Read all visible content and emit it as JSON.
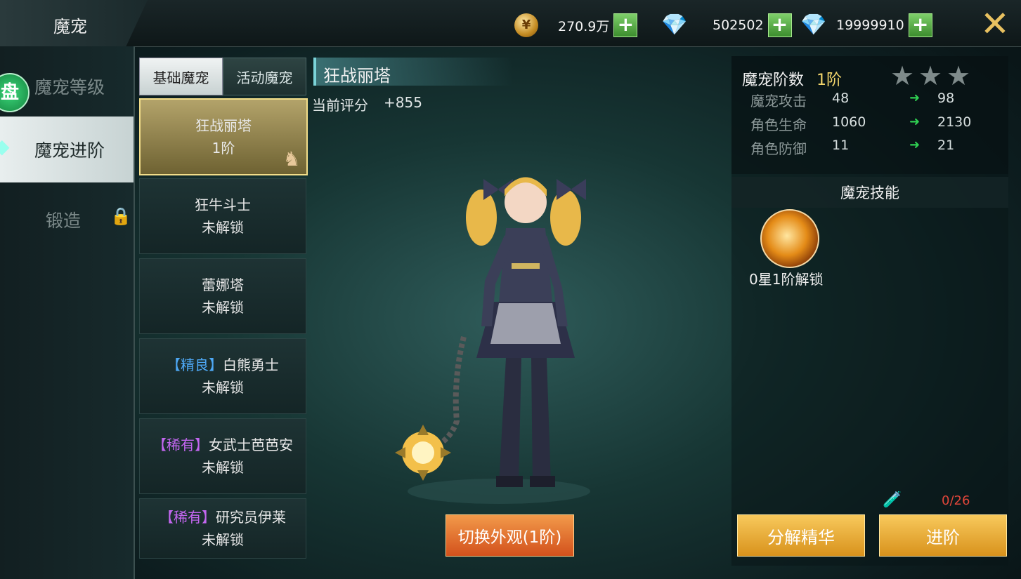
{
  "header": {
    "title": "魔宠",
    "gold": "270.9万",
    "diamond_blue": "502502",
    "diamond_bound": "19999910",
    "coin_glyph": "¥",
    "plus_label": "+",
    "close_label": "✕"
  },
  "sidebar": {
    "items": [
      {
        "label": "魔宠等级"
      },
      {
        "label": "魔宠进阶"
      },
      {
        "label": "锻造"
      }
    ],
    "badge": "盘"
  },
  "tabs": {
    "basic": "基础魔宠",
    "event": "活动魔宠"
  },
  "pets": [
    {
      "tag": "",
      "name": "狂战丽塔",
      "status": "1阶"
    },
    {
      "tag": "",
      "name": "狂牛斗士",
      "status": "未解锁"
    },
    {
      "tag": "",
      "name": "蕾娜塔",
      "status": "未解锁"
    },
    {
      "tag": "【精良】",
      "name": "白熊勇士",
      "status": "未解锁"
    },
    {
      "tag": "【稀有】",
      "name": "女武士芭芭安",
      "status": "未解锁"
    },
    {
      "tag": "【稀有】",
      "name": "研究员伊莱",
      "status": "未解锁"
    }
  ],
  "main": {
    "pet_name": "狂战丽塔",
    "score_label": "当前评分",
    "score_value": "+855",
    "switch_button": "切换外观(1阶)"
  },
  "stats": {
    "rank_label": "魔宠阶数",
    "rank_value": "1阶",
    "stars_lit": 0,
    "stars_total": 3,
    "rows": [
      {
        "label": "魔宠攻击",
        "current": "48",
        "next": "98"
      },
      {
        "label": "角色生命",
        "current": "1060",
        "next": "2130"
      },
      {
        "label": "角色防御",
        "current": "11",
        "next": "21"
      }
    ]
  },
  "skills": {
    "heading": "魔宠技能",
    "unlock_text": "0星1阶解锁"
  },
  "footer": {
    "item_count": "0/26",
    "decompose_button": "分解精华",
    "advance_button": "进阶"
  },
  "colors": {
    "accent_gold": "#f3d66c",
    "count_red": "#e0463a",
    "tag_blue": "#4ea8f5",
    "tag_purple": "#c266ef",
    "arrow_green": "#2fd052"
  }
}
